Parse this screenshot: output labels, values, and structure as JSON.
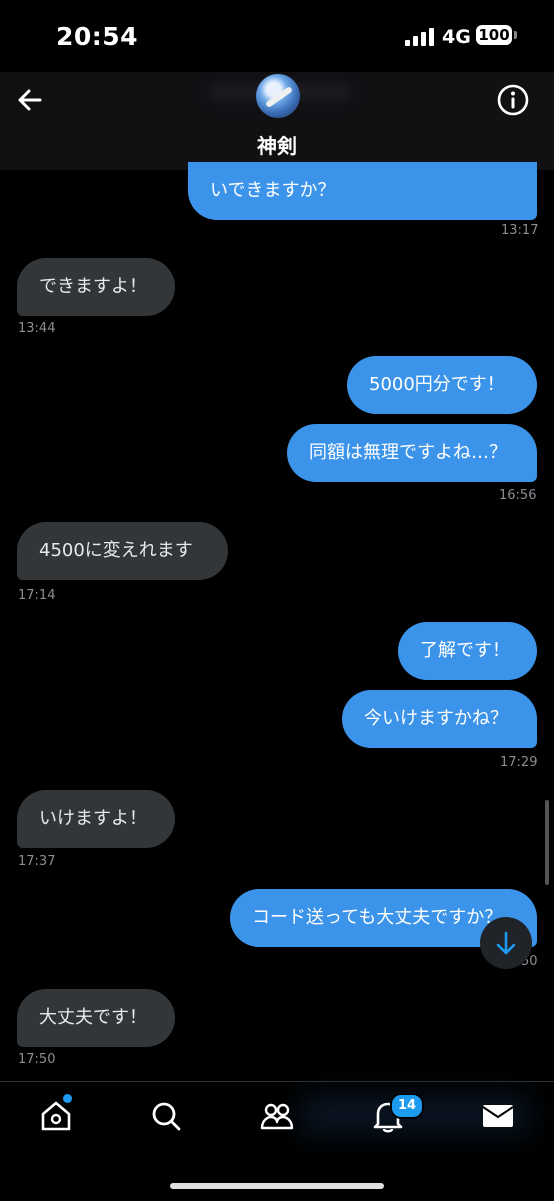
{
  "status": {
    "time": "20:54",
    "network": "4G",
    "battery": "100"
  },
  "header": {
    "contact_name": "神剣"
  },
  "messages": [
    {
      "text": "いできますか？"
    },
    {
      "text": "13:17"
    },
    {
      "text": "できますよ！"
    },
    {
      "text": "13:44"
    },
    {
      "text": "5000円分です！"
    },
    {
      "text": "同額は無理ですよね…？"
    },
    {
      "text": "16:56"
    },
    {
      "text": "4500に変えれます"
    },
    {
      "text": "17:14"
    },
    {
      "text": "了解です！"
    },
    {
      "text": "今いけますかね？"
    },
    {
      "text": "17:29"
    },
    {
      "text": "いけますよ！"
    },
    {
      "text": "17:37"
    },
    {
      "text": "コード送っても大丈夫ですか？"
    },
    {
      "text": "50"
    },
    {
      "text": "大丈夫です！"
    },
    {
      "text": "17:50"
    }
  ],
  "nav": {
    "notifications_badge": "14"
  },
  "colors": {
    "outgoing_bubble": "#3c94ea",
    "incoming_bubble": "#333639",
    "accent": "#1d9bf0"
  }
}
